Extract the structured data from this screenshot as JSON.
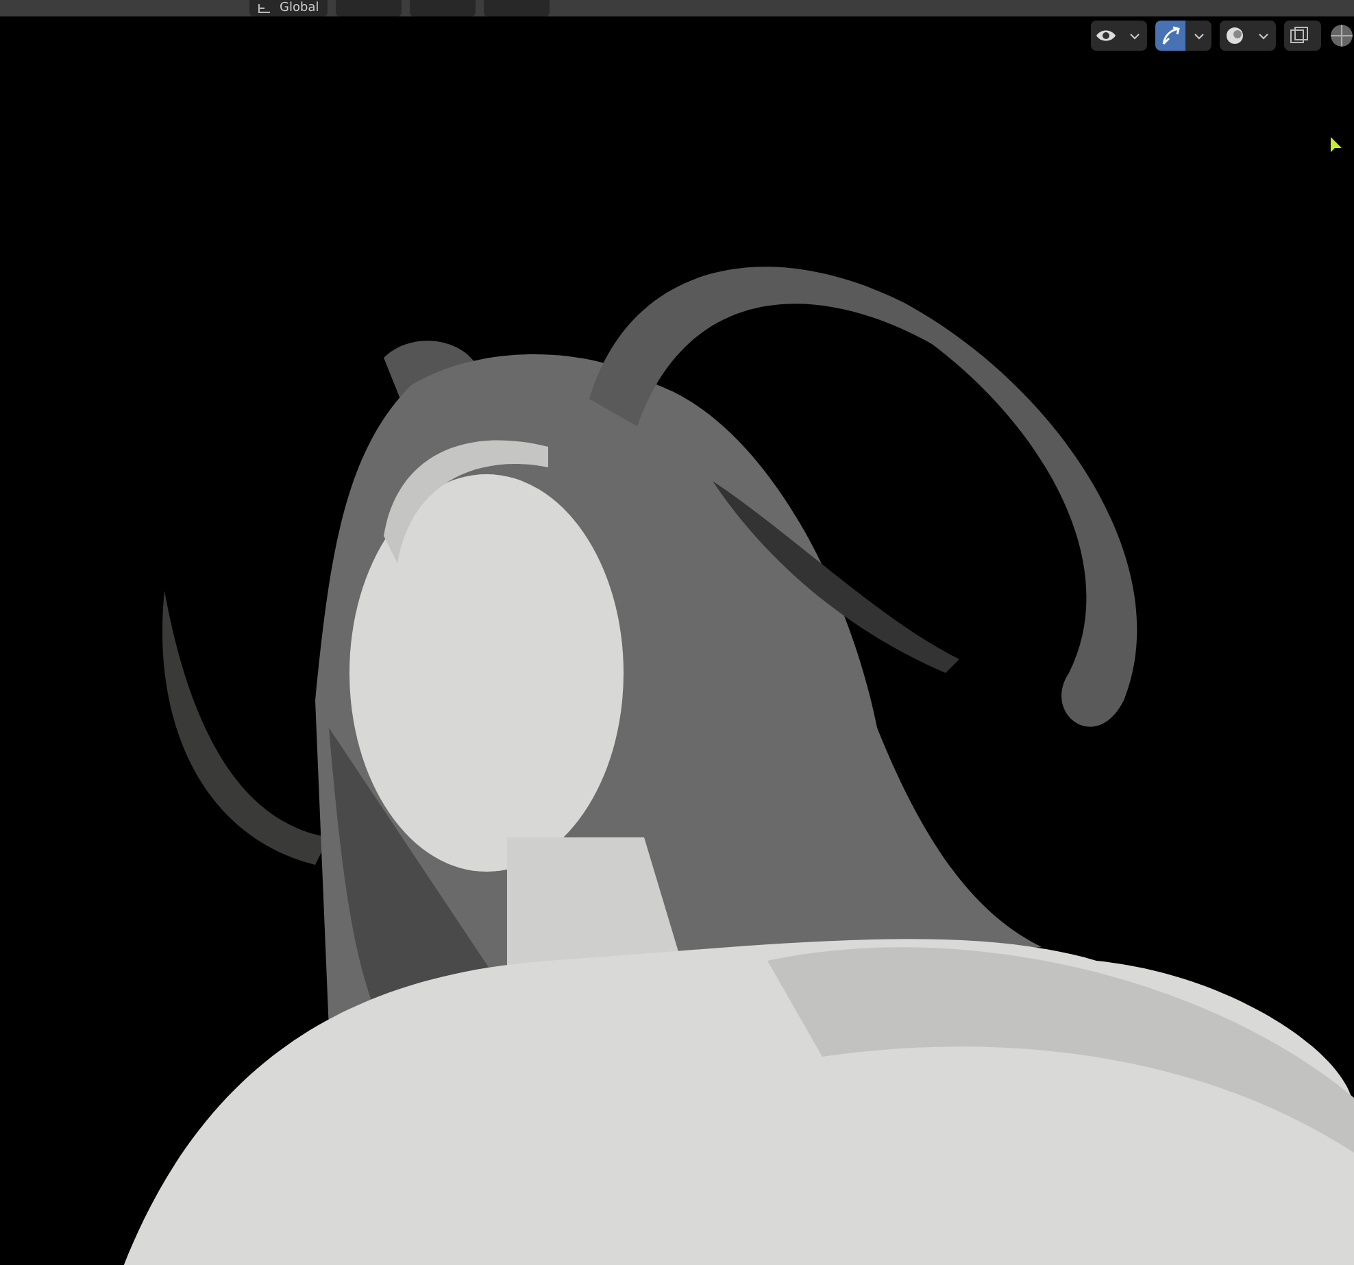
{
  "top_header": {
    "orientation": "Global"
  },
  "viewport_buttons": [
    {
      "kind": "visibility",
      "on": false
    },
    {
      "kind": "gizmo",
      "on": true
    },
    {
      "kind": "shading",
      "on": false
    },
    {
      "kind": "xray",
      "on": false
    }
  ]
}
